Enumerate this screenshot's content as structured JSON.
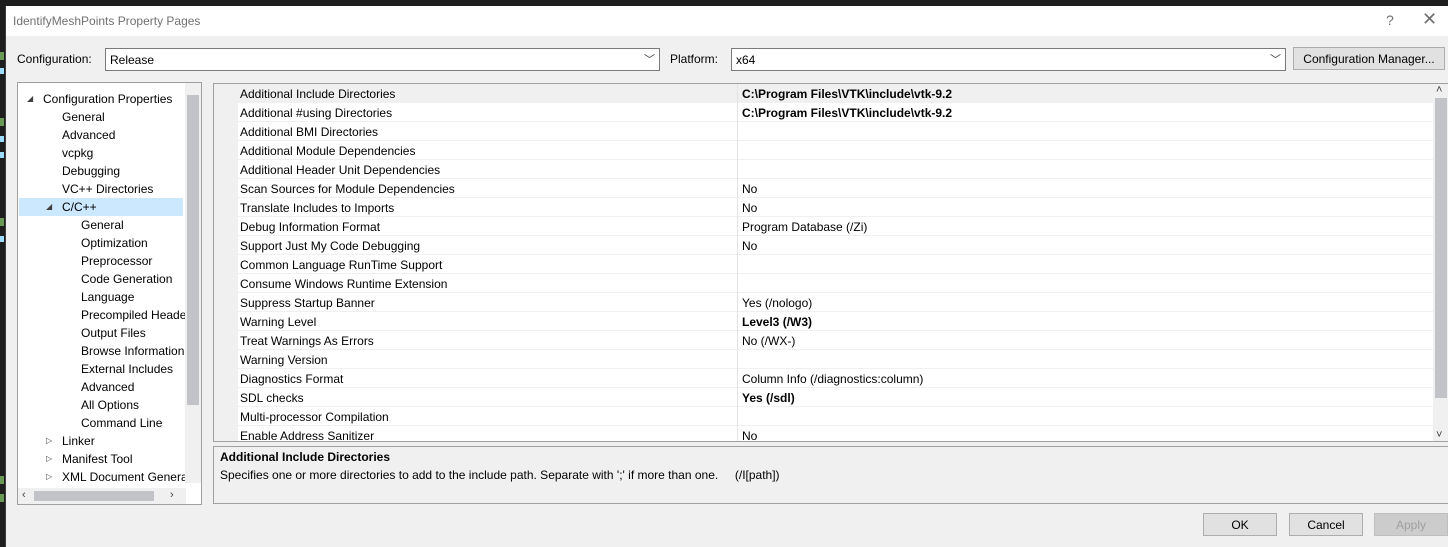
{
  "window": {
    "title": "IdentifyMeshPoints Property Pages",
    "help_glyph": "?",
    "close_glyph": "✕"
  },
  "config": {
    "label": "Configuration:",
    "value": "Release"
  },
  "platform": {
    "label": "Platform:",
    "value": "x64"
  },
  "config_manager_label": "Configuration Manager...",
  "tree": {
    "items": [
      {
        "label": "Configuration Properties",
        "level": 0,
        "expander": "expanded",
        "selected": false
      },
      {
        "label": "General",
        "level": 1,
        "expander": "none",
        "selected": false
      },
      {
        "label": "Advanced",
        "level": 1,
        "expander": "none",
        "selected": false
      },
      {
        "label": "vcpkg",
        "level": 1,
        "expander": "none",
        "selected": false
      },
      {
        "label": "Debugging",
        "level": 1,
        "expander": "none",
        "selected": false
      },
      {
        "label": "VC++ Directories",
        "level": 1,
        "expander": "none",
        "selected": false
      },
      {
        "label": "C/C++",
        "level": 1,
        "expander": "expanded",
        "selected": true
      },
      {
        "label": "General",
        "level": 2,
        "expander": "none",
        "selected": false
      },
      {
        "label": "Optimization",
        "level": 2,
        "expander": "none",
        "selected": false
      },
      {
        "label": "Preprocessor",
        "level": 2,
        "expander": "none",
        "selected": false
      },
      {
        "label": "Code Generation",
        "level": 2,
        "expander": "none",
        "selected": false
      },
      {
        "label": "Language",
        "level": 2,
        "expander": "none",
        "selected": false
      },
      {
        "label": "Precompiled Heade",
        "level": 2,
        "expander": "none",
        "selected": false
      },
      {
        "label": "Output Files",
        "level": 2,
        "expander": "none",
        "selected": false
      },
      {
        "label": "Browse Information",
        "level": 2,
        "expander": "none",
        "selected": false
      },
      {
        "label": "External Includes",
        "level": 2,
        "expander": "none",
        "selected": false
      },
      {
        "label": "Advanced",
        "level": 2,
        "expander": "none",
        "selected": false
      },
      {
        "label": "All Options",
        "level": 2,
        "expander": "none",
        "selected": false
      },
      {
        "label": "Command Line",
        "level": 2,
        "expander": "none",
        "selected": false
      },
      {
        "label": "Linker",
        "level": 1,
        "expander": "collapsed",
        "selected": false
      },
      {
        "label": "Manifest Tool",
        "level": 1,
        "expander": "collapsed",
        "selected": false
      },
      {
        "label": "XML Document Genera",
        "level": 1,
        "expander": "collapsed",
        "selected": false
      }
    ]
  },
  "properties": [
    {
      "name": "Additional Include Directories",
      "value": "C:\\Program Files\\VTK\\include\\vtk-9.2",
      "bold": true,
      "selected": true
    },
    {
      "name": "Additional #using Directories",
      "value": "C:\\Program Files\\VTK\\include\\vtk-9.2",
      "bold": true,
      "selected": false
    },
    {
      "name": "Additional BMI Directories",
      "value": "",
      "bold": false,
      "selected": false
    },
    {
      "name": "Additional Module Dependencies",
      "value": "",
      "bold": false,
      "selected": false
    },
    {
      "name": "Additional Header Unit Dependencies",
      "value": "",
      "bold": false,
      "selected": false
    },
    {
      "name": "Scan Sources for Module Dependencies",
      "value": "No",
      "bold": false,
      "selected": false
    },
    {
      "name": "Translate Includes to Imports",
      "value": "No",
      "bold": false,
      "selected": false
    },
    {
      "name": "Debug Information Format",
      "value": "Program Database (/Zi)",
      "bold": false,
      "selected": false
    },
    {
      "name": "Support Just My Code Debugging",
      "value": "No",
      "bold": false,
      "selected": false
    },
    {
      "name": "Common Language RunTime Support",
      "value": "",
      "bold": false,
      "selected": false
    },
    {
      "name": "Consume Windows Runtime Extension",
      "value": "",
      "bold": false,
      "selected": false
    },
    {
      "name": "Suppress Startup Banner",
      "value": "Yes (/nologo)",
      "bold": false,
      "selected": false
    },
    {
      "name": "Warning Level",
      "value": "Level3 (/W3)",
      "bold": true,
      "selected": false
    },
    {
      "name": "Treat Warnings As Errors",
      "value": "No (/WX-)",
      "bold": false,
      "selected": false
    },
    {
      "name": "Warning Version",
      "value": "",
      "bold": false,
      "selected": false
    },
    {
      "name": "Diagnostics Format",
      "value": "Column Info (/diagnostics:column)",
      "bold": false,
      "selected": false
    },
    {
      "name": "SDL checks",
      "value": "Yes (/sdl)",
      "bold": true,
      "selected": false
    },
    {
      "name": "Multi-processor Compilation",
      "value": "",
      "bold": false,
      "selected": false
    },
    {
      "name": "Enable Address Sanitizer",
      "value": "No",
      "bold": false,
      "selected": false
    }
  ],
  "description": {
    "title": "Additional Include Directories",
    "text": "Specifies one or more directories to add to the include path. Separate with ';' if more than one.     (/I[path])"
  },
  "buttons": {
    "ok": "OK",
    "cancel": "Cancel",
    "apply": "Apply"
  }
}
